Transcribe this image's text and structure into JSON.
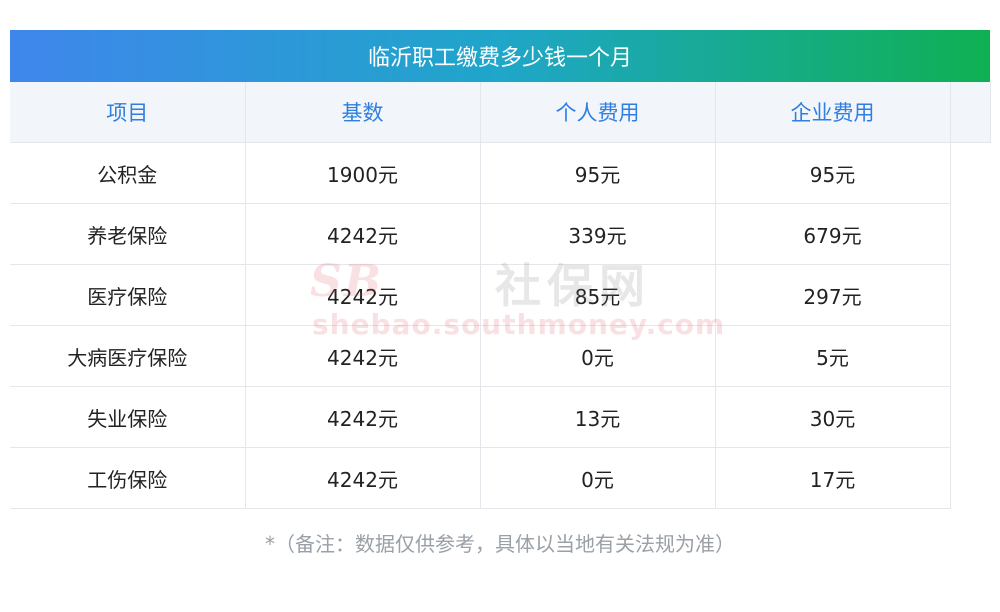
{
  "title": "临沂职工缴费多少钱一个月",
  "table": {
    "headers": [
      "项目",
      "基数",
      "个人费用",
      "企业费用"
    ],
    "rows": [
      [
        "公积金",
        "1900元",
        "95元",
        "95元"
      ],
      [
        "养老保险",
        "4242元",
        "339元",
        "679元"
      ],
      [
        "医疗保险",
        "4242元",
        "85元",
        "297元"
      ],
      [
        "大病医疗保险",
        "4242元",
        "0元",
        "5元"
      ],
      [
        "失业保险",
        "4242元",
        "13元",
        "30元"
      ],
      [
        "工伤保险",
        "4242元",
        "0元",
        "17元"
      ]
    ]
  },
  "watermark": {
    "logo": "SB",
    "name": "社保网",
    "url": "shebao.southmoney.com"
  },
  "footnote": "*（备注：数据仅供参考，具体以当地有关法规为准）"
}
